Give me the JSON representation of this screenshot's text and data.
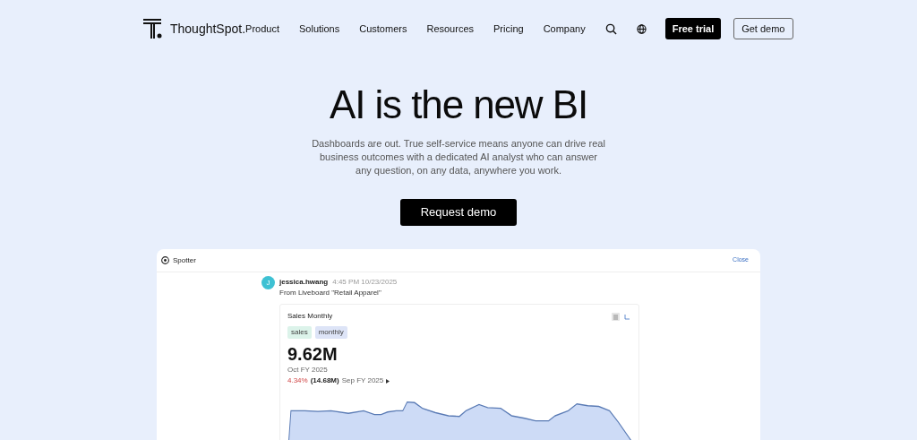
{
  "nav": {
    "brand": "ThoughtSpot.",
    "links": [
      "Product",
      "Solutions",
      "Customers",
      "Resources",
      "Pricing",
      "Company"
    ],
    "buttons": [
      {
        "label": "Free trial",
        "kind": "primary"
      },
      {
        "label": "Get demo",
        "kind": "outline"
      }
    ]
  },
  "hero": {
    "title": "AI is the new BI",
    "text": "Dashboards are out. True self-service means anyone can drive real business outcomes with a dedicated AI analyst who can answer any question, on any data, anywhere you work.",
    "button": "Request demo"
  },
  "app": {
    "title": "Spotter",
    "close": "Close",
    "message": {
      "avatar": "J",
      "user": "jessica.hwang",
      "time": "4:45 PM 10/23/2025",
      "text": "From Liveboard \"Retail Apparel\""
    },
    "card": {
      "title": "Sales Monthly",
      "tags": [
        {
          "label": "sales",
          "color": "#dcf3ea"
        },
        {
          "label": "monthly",
          "color": "#dde4f7"
        }
      ],
      "value": "9.62M",
      "period": "Oct FY 2025",
      "change": "4.34%",
      "previous": "(14.68M)",
      "previous_period": "Sep FY 2025"
    }
  }
}
